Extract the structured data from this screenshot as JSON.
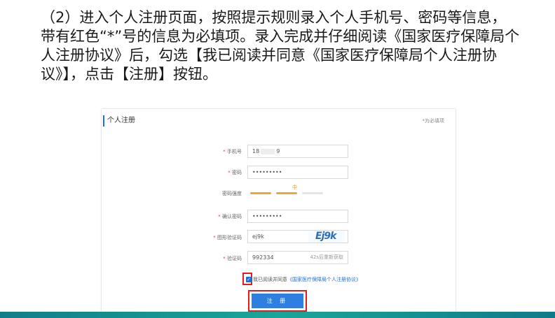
{
  "instruction": {
    "line1": "（2）进入个人注册页面，按照提示规则录入个人手机号、密码等信息，",
    "line2": "带有红色“*”号的信息为必填项。录入完成并仔细阅读《国家医疗保障局个",
    "line3": "人注册协议》后，勾选【我已阅读并同意《国家医疗保障局个人注册协",
    "line4": "议》】，点击【注册】按钮。"
  },
  "form": {
    "title": "个人注册",
    "required_note": "*为必填项",
    "phone_label": "手机号",
    "phone_prefix": "18",
    "phone_suffix": "9",
    "password_label": "密码",
    "password_value": "•••••••••",
    "strength_label": "密码强度",
    "strength_text": "中",
    "strength_level": "中",
    "confirm_label": "确认密码",
    "confirm_value": "•••••••••",
    "captcha_label": "图形验证码",
    "captcha_value": "ej9k",
    "captcha_image_text": "Ej9k",
    "sms_label": "验证码",
    "sms_value": "992334",
    "resend_text": "42s后重新获取",
    "agree_text": "我已阅读并同意",
    "agree_link": "《国家医疗保障局个人注册协议》",
    "register_button": "注 册"
  },
  "colors": {
    "accent": "#2f7fe0",
    "highlight": "#e21d1d",
    "strength": "#e8a93a",
    "band": "#1aa69a"
  }
}
